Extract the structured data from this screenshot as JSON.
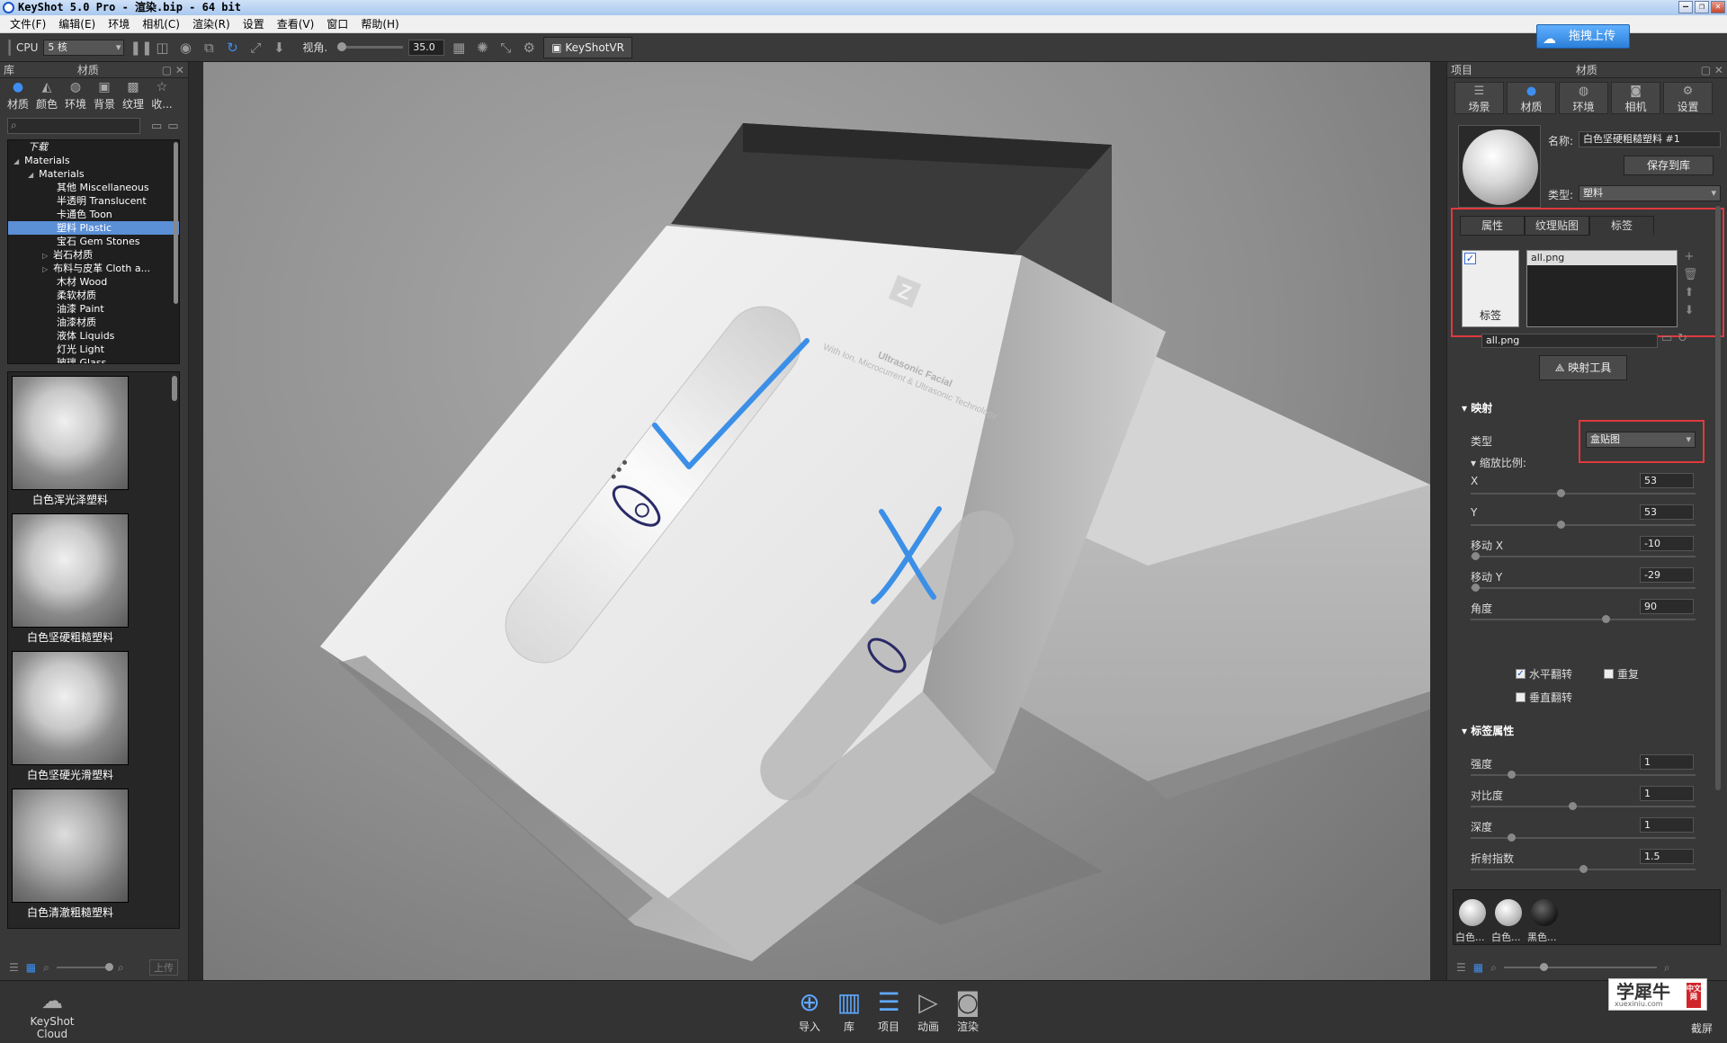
{
  "window": {
    "title": "KeyShot 5.0 Pro  - 渲染.bip  - 64 bit"
  },
  "menu": [
    "文件(F)",
    "编辑(E)",
    "环境",
    "相机(C)",
    "渲染(R)",
    "设置",
    "查看(V)",
    "窗口",
    "帮助(H)"
  ],
  "toolbar": {
    "cpu_label": "CPU",
    "cores": "5 核",
    "view_angle_label": "视角.",
    "view_angle_value": "35.0",
    "vr_button": "KeyShotVR"
  },
  "upload": {
    "label": "拖拽上传"
  },
  "library": {
    "panel_left": "库",
    "panel_title": "材质",
    "categories": [
      "材质",
      "颜色",
      "环境",
      "背景",
      "纹理",
      "收..."
    ],
    "tree": [
      {
        "label": "下载",
        "depth": 1,
        "italic": true
      },
      {
        "label": "Materials",
        "depth": 0,
        "arrow": "◢"
      },
      {
        "label": "Materials",
        "depth": 1,
        "arrow": "◢"
      },
      {
        "label": "其他 Miscellaneous",
        "depth": 3
      },
      {
        "label": "半透明 Translucent",
        "depth": 3
      },
      {
        "label": "卡通色 Toon",
        "depth": 3
      },
      {
        "label": "塑料 Plastic",
        "depth": 3,
        "selected": true
      },
      {
        "label": "宝石 Gem Stones",
        "depth": 3
      },
      {
        "label": "岩石材质",
        "depth": 2,
        "arrow": "▷"
      },
      {
        "label": "布料与皮革 Cloth a...",
        "depth": 2,
        "arrow": "▷"
      },
      {
        "label": "木材 Wood",
        "depth": 3
      },
      {
        "label": "柔软材质",
        "depth": 3
      },
      {
        "label": "油漆 Paint",
        "depth": 3
      },
      {
        "label": "油漆材质",
        "depth": 3
      },
      {
        "label": "液体 Liquids",
        "depth": 3
      },
      {
        "label": "灯光 Light",
        "depth": 3
      },
      {
        "label": "玻璃 Glass",
        "depth": 3
      }
    ],
    "thumbnails": [
      "白色浑光泽塑料",
      "白色坚硬粗糙塑料",
      "白色坚硬光滑塑料",
      "白色清澈粗糙塑料"
    ],
    "footer_button": "上传"
  },
  "project": {
    "panel_left": "项目",
    "panel_title": "材质",
    "tabs": [
      "场景",
      "材质",
      "环境",
      "相机",
      "设置"
    ],
    "name_label": "名称:",
    "name_value": "白色坚硬粗糙塑料 #1",
    "save_button": "保存到库",
    "type_label": "类型:",
    "type_value": "塑料",
    "sub_tabs": [
      "属性",
      "纹理贴图",
      "标签"
    ],
    "label_thumb_caption": "标签",
    "label_item": "all.png",
    "label_file": "all.png",
    "mapping_tool": "映射工具",
    "mapping_section": "映射",
    "mapping_type_label": "类型",
    "mapping_type_value": "盒贴图",
    "scale_section": "缩放比例:",
    "rows": [
      {
        "label": "X",
        "value": "53",
        "knob": 0.4
      },
      {
        "label": "Y",
        "value": "53",
        "knob": 0.4
      },
      {
        "label": "移动 X",
        "value": "-10",
        "knob": 0.02
      },
      {
        "label": "移动 Y",
        "value": "-29",
        "knob": 0.02
      },
      {
        "label": "角度",
        "value": "90",
        "knob": 0.6
      }
    ],
    "checks": {
      "flip_h": "水平翻转",
      "repeat": "重复",
      "flip_v": "垂直翻转"
    },
    "label_props_section": "标签属性",
    "props": [
      {
        "label": "强度",
        "value": "1",
        "knob": 0.18
      },
      {
        "label": "对比度",
        "value": "1",
        "knob": 0.45
      },
      {
        "label": "深度",
        "value": "1",
        "knob": 0.18
      },
      {
        "label": "折射指数",
        "value": "1.5",
        "knob": 0.5
      }
    ],
    "materials_strip": [
      "白色...",
      "白色...",
      "黑色..."
    ]
  },
  "scene": {
    "package_title": "Ultrasonic Facial",
    "package_subtitle": "With Ion, Microcurrent & Ultrasonic Technology",
    "logo_glyph": "Z"
  },
  "bottom": {
    "cloud": "KeyShot Cloud",
    "items": [
      "导入",
      "库",
      "项目",
      "动画",
      "渲染"
    ],
    "screenshot": "截屏"
  },
  "watermark": {
    "brand": "学犀牛",
    "url": "xuexiniu.com",
    "seal": "中文网"
  }
}
